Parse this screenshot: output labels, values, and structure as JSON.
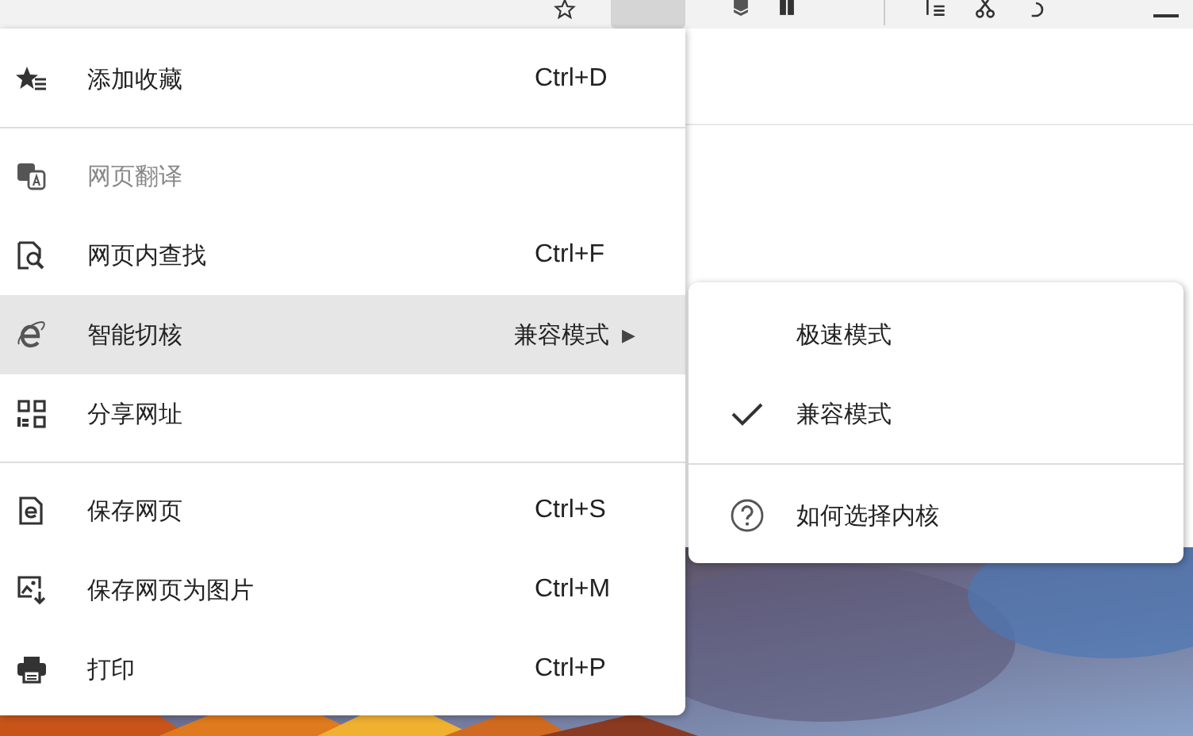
{
  "menu": {
    "items": [
      {
        "kind": "item",
        "label": "添加收藏",
        "shortcut": "Ctrl+D",
        "disabled": false,
        "selected": false
      },
      {
        "kind": "separator"
      },
      {
        "kind": "item",
        "label": "网页翻译",
        "disabled": true,
        "selected": false
      },
      {
        "kind": "item",
        "label": "网页内查找",
        "shortcut": "Ctrl+F",
        "disabled": false,
        "selected": false
      },
      {
        "kind": "submenu",
        "label": "智能切核",
        "value": "兼容模式",
        "arrow": "▶",
        "disabled": false,
        "selected": true
      },
      {
        "kind": "item",
        "label": "分享网址",
        "disabled": false,
        "selected": false
      },
      {
        "kind": "separator"
      },
      {
        "kind": "item",
        "label": "保存网页",
        "shortcut": "Ctrl+S",
        "disabled": false,
        "selected": false
      },
      {
        "kind": "item",
        "label": "保存网页为图片",
        "shortcut": "Ctrl+M",
        "disabled": false,
        "selected": false
      },
      {
        "kind": "item",
        "label": "打印",
        "shortcut": "Ctrl+P",
        "disabled": false,
        "selected": false
      }
    ]
  },
  "submenu": {
    "items": [
      {
        "kind": "option",
        "label": "极速模式",
        "checked": false
      },
      {
        "kind": "option",
        "label": "兼容模式",
        "checked": true
      },
      {
        "kind": "separator"
      },
      {
        "kind": "help",
        "label": "如何选择内核"
      }
    ]
  }
}
